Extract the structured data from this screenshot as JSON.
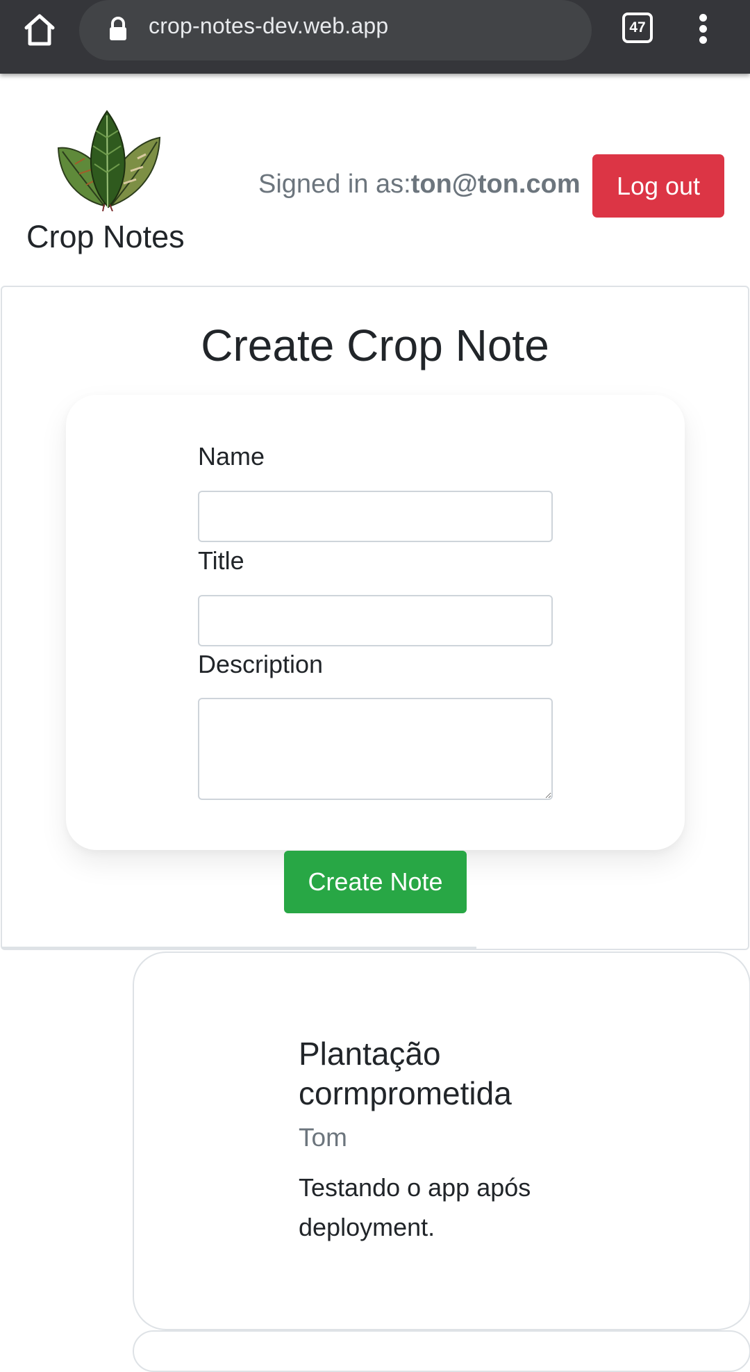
{
  "browser": {
    "url": "crop-notes-dev.web.app",
    "tab_count": "47",
    "icons": [
      "home-icon",
      "lock-icon",
      "tabs-icon",
      "more-vert-icon"
    ]
  },
  "header": {
    "brand": "Crop Notes",
    "signed_in_label": "Signed in as:",
    "user_email": "ton@ton.com",
    "logout_label": "Log out",
    "logout_color": "#dc3545"
  },
  "form": {
    "title": "Create Crop Note",
    "name_label": "Name",
    "name_value": "",
    "title_label": "Title",
    "title_value": "",
    "description_label": "Description",
    "description_value": "",
    "submit_label": "Create Note",
    "submit_color": "#28a745"
  },
  "notes": [
    {
      "title": "Plantação cormprometida",
      "author": "Tom",
      "description": "Testando o app após deployment."
    }
  ]
}
